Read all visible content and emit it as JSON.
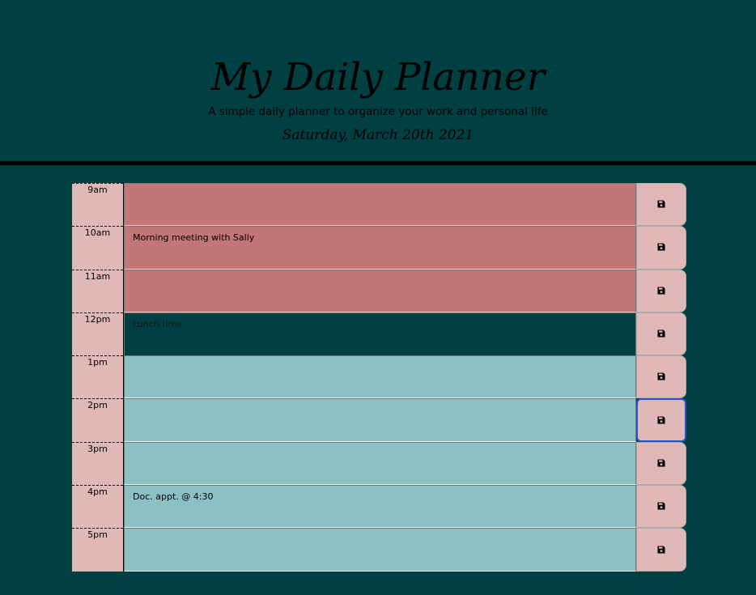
{
  "header": {
    "title": "My Daily Planner",
    "lead": "A simple daily planner to organize your work and personal life",
    "current_day": "Saturday, March 20th 2021"
  },
  "colors": {
    "past": "#c27677",
    "present": "#003f42",
    "future": "#8bc1c2",
    "hour_bg": "#e0b8b8",
    "page_bg": "#003f42"
  },
  "icons": {
    "save": "floppy-disk-icon"
  },
  "time_blocks": [
    {
      "hour": "9am",
      "text": "",
      "state": "past"
    },
    {
      "hour": "10am",
      "text": "Morning meeting with Sally",
      "state": "past"
    },
    {
      "hour": "11am",
      "text": "",
      "state": "past"
    },
    {
      "hour": "12pm",
      "text": "Lunch time",
      "state": "present"
    },
    {
      "hour": "1pm",
      "text": "",
      "state": "future"
    },
    {
      "hour": "2pm",
      "text": "",
      "state": "future"
    },
    {
      "hour": "3pm",
      "text": "",
      "state": "future"
    },
    {
      "hour": "4pm",
      "text": "Doc. appt. @ 4:30",
      "state": "future"
    },
    {
      "hour": "5pm",
      "text": "",
      "state": "future"
    }
  ]
}
